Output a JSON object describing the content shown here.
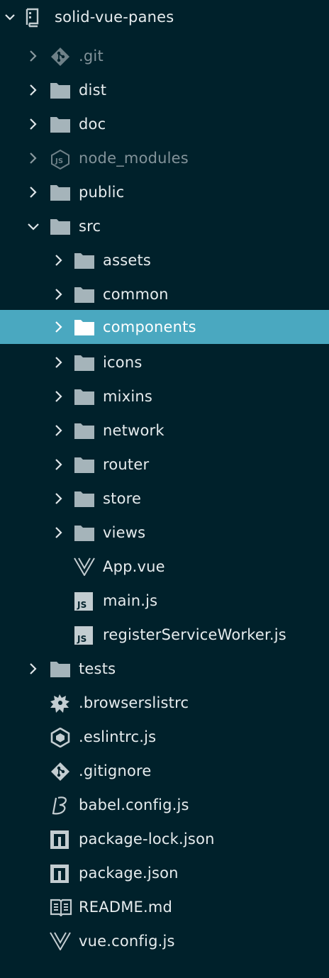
{
  "explorer": {
    "root": {
      "label": "solid-vue-panes",
      "icon": "repo-icon",
      "expanded": true
    },
    "items": [
      {
        "label": ".git",
        "icon": "git-icon",
        "kind": "folder",
        "expanded": false,
        "dimmed": true
      },
      {
        "label": "dist",
        "icon": "folder-icon",
        "kind": "folder",
        "expanded": false
      },
      {
        "label": "doc",
        "icon": "folder-icon",
        "kind": "folder",
        "expanded": false
      },
      {
        "label": "node_modules",
        "icon": "nodejs-icon",
        "kind": "folder",
        "expanded": false,
        "dimmed": true
      },
      {
        "label": "public",
        "icon": "folder-icon",
        "kind": "folder",
        "expanded": false
      },
      {
        "label": "src",
        "icon": "folder-icon",
        "kind": "folder",
        "expanded": true
      },
      {
        "label": "assets",
        "icon": "folder-icon",
        "kind": "folder",
        "expanded": false
      },
      {
        "label": "common",
        "icon": "folder-icon",
        "kind": "folder",
        "expanded": false
      },
      {
        "label": "components",
        "icon": "folder-icon",
        "kind": "folder",
        "expanded": false,
        "selected": true
      },
      {
        "label": "icons",
        "icon": "folder-icon",
        "kind": "folder",
        "expanded": false
      },
      {
        "label": "mixins",
        "icon": "folder-icon",
        "kind": "folder",
        "expanded": false
      },
      {
        "label": "network",
        "icon": "folder-icon",
        "kind": "folder",
        "expanded": false
      },
      {
        "label": "router",
        "icon": "folder-icon",
        "kind": "folder",
        "expanded": false
      },
      {
        "label": "store",
        "icon": "folder-icon",
        "kind": "folder",
        "expanded": false
      },
      {
        "label": "views",
        "icon": "folder-icon",
        "kind": "folder",
        "expanded": false
      },
      {
        "label": "App.vue",
        "icon": "vue-icon",
        "kind": "file"
      },
      {
        "label": "main.js",
        "icon": "js-icon",
        "kind": "file"
      },
      {
        "label": "registerServiceWorker.js",
        "icon": "js-icon",
        "kind": "file"
      },
      {
        "label": "tests",
        "icon": "folder-icon",
        "kind": "folder",
        "expanded": false
      },
      {
        "label": ".browserslistrc",
        "icon": "browserslist-icon",
        "kind": "file"
      },
      {
        "label": ".eslintrc.js",
        "icon": "eslint-icon",
        "kind": "file"
      },
      {
        "label": ".gitignore",
        "icon": "git-icon",
        "kind": "file"
      },
      {
        "label": "babel.config.js",
        "icon": "babel-icon",
        "kind": "file"
      },
      {
        "label": "package-lock.json",
        "icon": "npm-icon",
        "kind": "file"
      },
      {
        "label": "package.json",
        "icon": "npm-icon",
        "kind": "file"
      },
      {
        "label": "README.md",
        "icon": "readme-icon",
        "kind": "file"
      },
      {
        "label": "vue.config.js",
        "icon": "vue-icon",
        "kind": "file"
      }
    ]
  },
  "colors": {
    "background": "#00212b",
    "selection": "#4aa8c0",
    "text": "#e6ecee",
    "dim_text": "#82939a",
    "folder": "#a5b4ba",
    "icon": "#c3cdd1"
  }
}
